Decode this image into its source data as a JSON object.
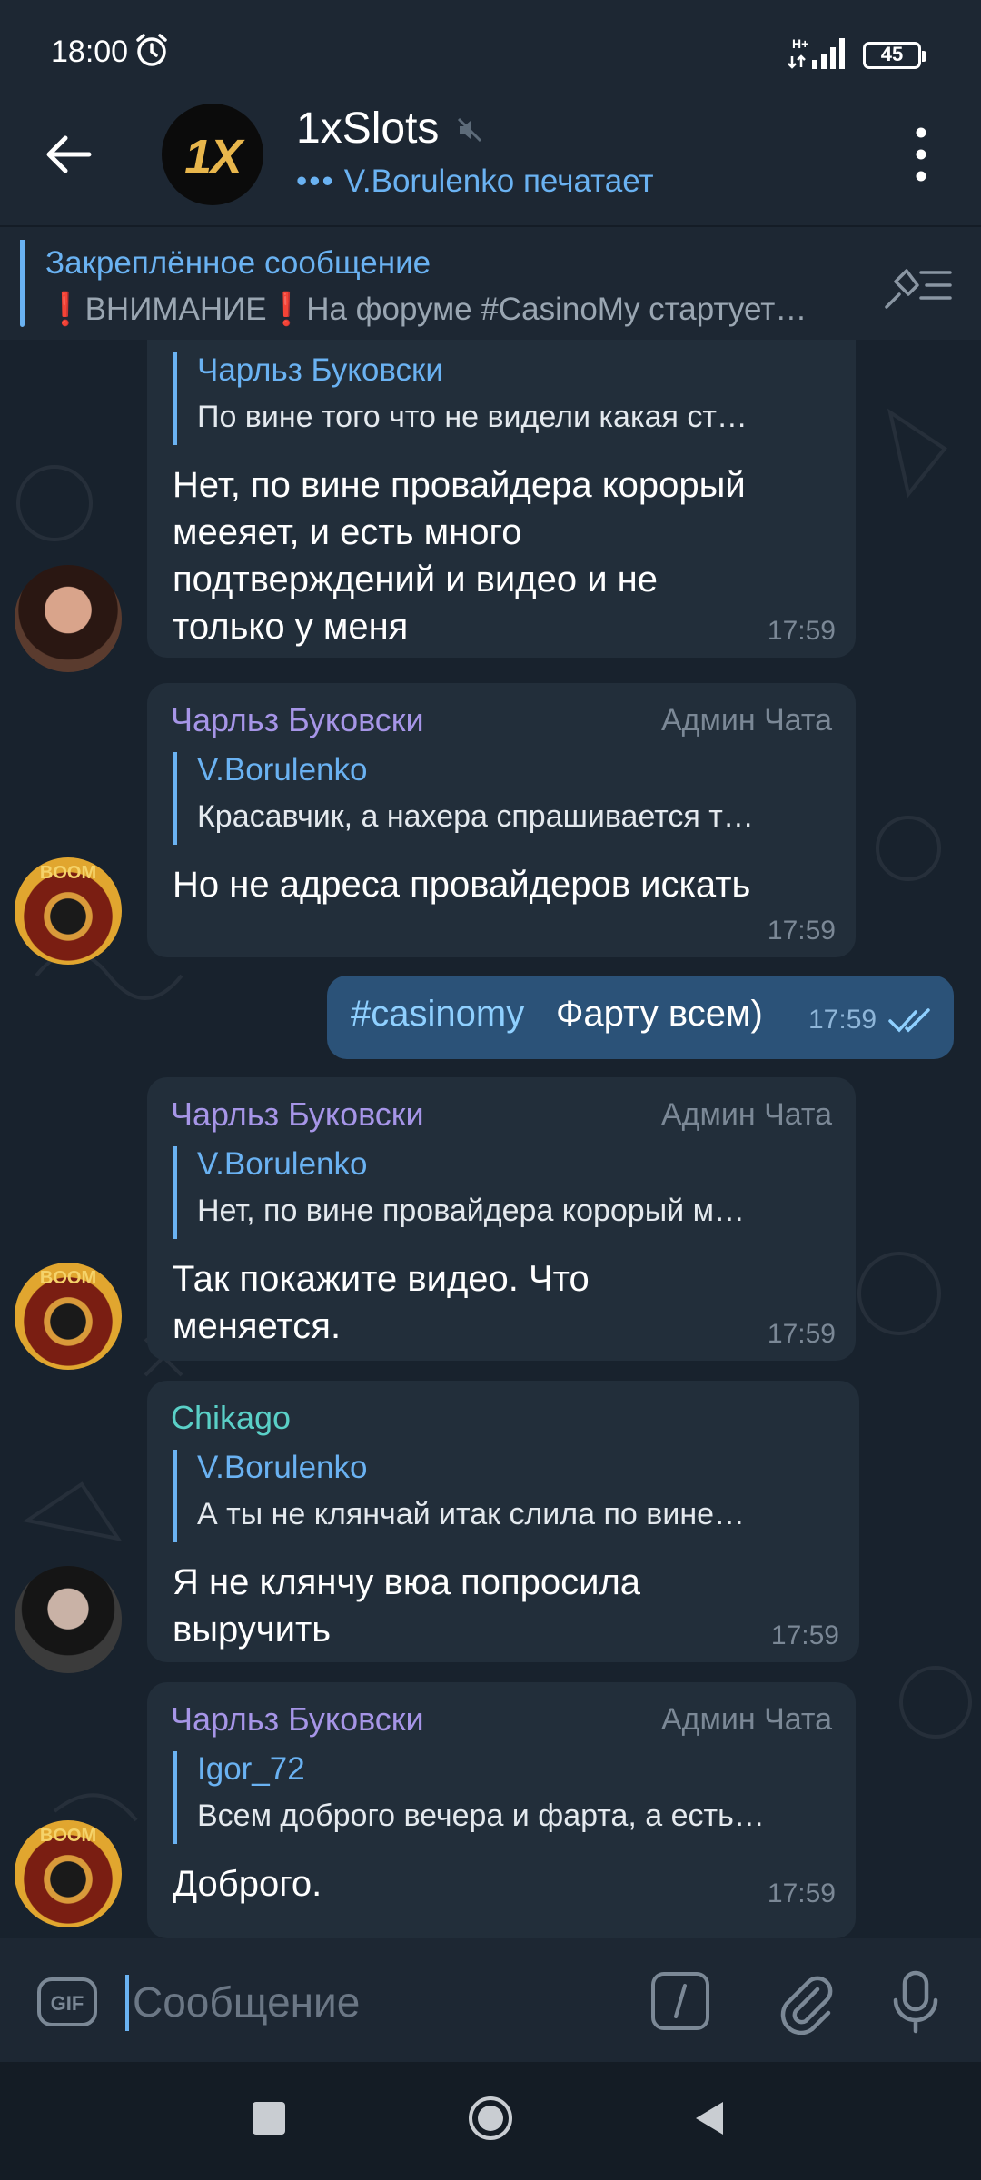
{
  "status_bar": {
    "time": "18:00",
    "network": "H+",
    "battery": "45"
  },
  "header": {
    "title": "1xSlots",
    "avatar_text": "1X",
    "subtitle_dots": "•••",
    "subtitle": "V.Borulenko печатает"
  },
  "pinned": {
    "title": "Закреплённое сообщение",
    "text": "❗ВНИМАНИЕ❗На форуме #CasinoMy стартует…"
  },
  "messages": [
    {
      "reply_name": "Чарльз Буковски",
      "reply_text": "По вине того что не видели какая ст…",
      "text": "Нет, по вине провайдера корорый мееяет, и есть много подтверждений и видео и не только у меня",
      "time": "17:59"
    },
    {
      "sender": "Чарльз Буковски",
      "role": "Админ Чата",
      "reply_name": "V.Borulenko",
      "reply_text": "Красавчик, а нахера спрашивается т…",
      "text": "Но не адреса провайдеров искать",
      "time": "17:59"
    },
    {
      "outgoing": true,
      "hashtag": "#casinomy",
      "text": "Фарту всем)",
      "time": "17:59"
    },
    {
      "sender": "Чарльз Буковски",
      "role": "Админ Чата",
      "reply_name": "V.Borulenko",
      "reply_text": "Нет, по вине провайдера корорый м…",
      "text": "Так покажите видео. Что меняется.",
      "time": "17:59"
    },
    {
      "sender": "Chikago",
      "reply_name": "V.Borulenko",
      "reply_text": "А ты не клянчай  итак слила по вине…",
      "text": "Я не клянчу вюа попросила выручить",
      "time": "17:59"
    },
    {
      "sender": "Чарльз Буковски",
      "role": "Админ Чата",
      "reply_name": "Igor_72",
      "reply_text": "Всем доброго вечера и фарта, а есть…",
      "text": "Доброго.",
      "time": "17:59"
    }
  ],
  "avatar_badge": "BOOM",
  "input": {
    "placeholder": "Сообщение",
    "gif_label": "GIF"
  },
  "colors": {
    "accent": "#6ab2f2",
    "admin_name": "#a695e7",
    "chikago_name": "#5ad0c7",
    "incoming_bubble": "#222e3a",
    "outgoing_bubble": "#2b5278"
  }
}
